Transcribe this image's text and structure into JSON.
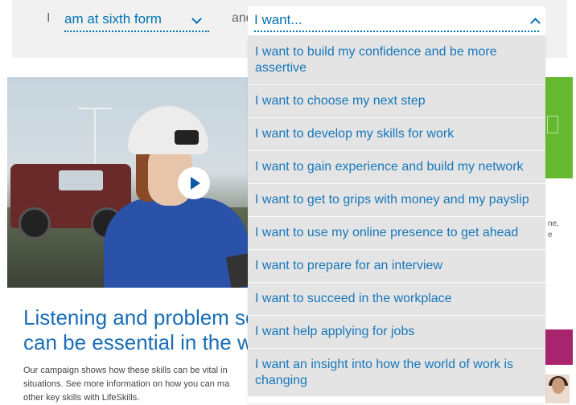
{
  "selector": {
    "prefix": "I",
    "first_value": "am at sixth form",
    "conjunction": "and",
    "second_placeholder": "I want..."
  },
  "options": [
    "I want to build my confidence and be more assertive",
    "I want to choose my next step",
    "I want to develop my skills for work",
    "I want to gain experience and build my network",
    "I want to get to grips with money and my payslip",
    "I want to use my online presence to get ahead",
    "I want to prepare for an interview",
    "I want to succeed in the workplace",
    "I want help applying for jobs",
    "I want an insight into how the world of work is changing"
  ],
  "article": {
    "headline_line1": "Listening and problem so",
    "headline_line2": "can be essential in the wo",
    "body_line1": "Our campaign shows how these skills can be vital in",
    "body_line2": "situations. See more information on how you can ma",
    "body_line3": "other key skills with LifeSkills."
  },
  "side": {
    "line1": "ne,",
    "line2": "e"
  },
  "colors": {
    "accent": "#0073b1",
    "option_bg": "#e4e4e4",
    "green_tile": "#66b830",
    "magenta_tile": "#a8246e"
  }
}
